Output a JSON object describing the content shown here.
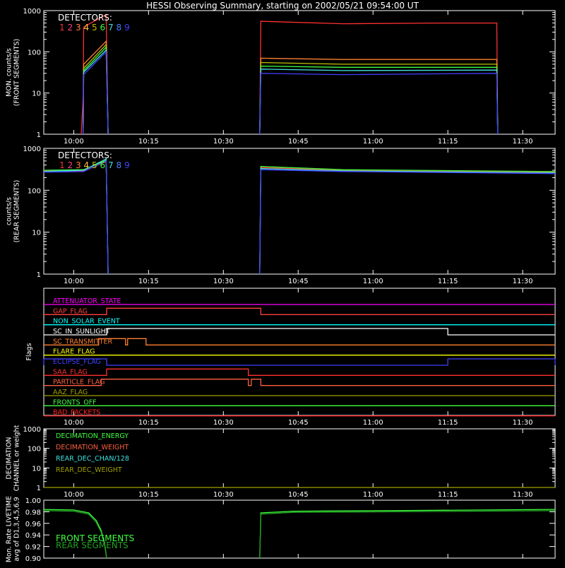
{
  "title": "HESSI Observing Summary, starting on 2002/05/21 09:54:00 UT",
  "time_ticks": [
    "10:00",
    "10:15",
    "10:30",
    "10:45",
    "11:00",
    "11:15",
    "11:30"
  ],
  "time_tick_minutes": [
    6,
    21,
    36,
    51,
    66,
    81,
    96
  ],
  "x_range_minutes": [
    0,
    102.5
  ],
  "detectors_label": "DETECTORS:",
  "detector_numbers": [
    "1",
    "2",
    "3",
    "4",
    "5",
    "6",
    "7",
    "8",
    "9"
  ],
  "detector_colors": [
    "#ff3030",
    "#ff4080",
    "#ff8030",
    "#ffc040",
    "#c0c000",
    "#40ff40",
    "#40e0e0",
    "#4080ff",
    "#4040ff"
  ],
  "chart_data": [
    {
      "type": "line",
      "name": "front",
      "ylabel": "MON. counts/s\n(FRONT SEGMENTS)",
      "ylog": true,
      "ylim": [
        1,
        1000
      ],
      "yticks": [
        "1",
        "10",
        "100",
        "1000"
      ],
      "series": [
        {
          "name": "1",
          "color": "#ff3030",
          "segments": [
            [
              [
                7.5,
                1
              ],
              [
                7.9,
                8
              ],
              [
                8.0,
                400
              ],
              [
                12.5,
                800
              ],
              [
                12.9,
                1
              ]
            ],
            [
              [
                43.3,
                1
              ],
              [
                43.5,
                550
              ],
              [
                60,
                480
              ],
              [
                80,
                500
              ],
              [
                90.8,
                500
              ],
              [
                91,
                1
              ]
            ]
          ]
        },
        {
          "name": "2",
          "color": "#ff8030",
          "segments": [
            [
              [
                7.9,
                1
              ],
              [
                8.0,
                50
              ],
              [
                12.5,
                180
              ],
              [
                12.9,
                1
              ]
            ],
            [
              [
                43.3,
                1
              ],
              [
                43.5,
                70
              ],
              [
                60,
                65
              ],
              [
                90.8,
                65
              ],
              [
                91,
                1
              ]
            ]
          ]
        },
        {
          "name": "3",
          "color": "#c0c000",
          "segments": [
            [
              [
                7.9,
                1
              ],
              [
                8.0,
                40
              ],
              [
                12.5,
                150
              ],
              [
                12.9,
                1
              ]
            ],
            [
              [
                43.3,
                1
              ],
              [
                43.5,
                55
              ],
              [
                60,
                50
              ],
              [
                90.8,
                50
              ],
              [
                91,
                1
              ]
            ]
          ]
        },
        {
          "name": "6",
          "color": "#40ff40",
          "segments": [
            [
              [
                7.9,
                1
              ],
              [
                8.0,
                35
              ],
              [
                12.5,
                130
              ],
              [
                12.9,
                1
              ]
            ],
            [
              [
                43.3,
                1
              ],
              [
                43.5,
                45
              ],
              [
                60,
                42
              ],
              [
                90.8,
                42
              ],
              [
                91,
                1
              ]
            ]
          ]
        },
        {
          "name": "7",
          "color": "#40e0e0",
          "segments": [
            [
              [
                7.9,
                1
              ],
              [
                8.0,
                32
              ],
              [
                12.5,
                110
              ],
              [
                12.9,
                1
              ]
            ],
            [
              [
                43.3,
                1
              ],
              [
                43.5,
                38
              ],
              [
                60,
                35
              ],
              [
                90.8,
                36
              ],
              [
                91,
                1
              ]
            ]
          ]
        },
        {
          "name": "8",
          "color": "#4040ff",
          "segments": [
            [
              [
                7.9,
                1
              ],
              [
                8.0,
                28
              ],
              [
                12.5,
                100
              ],
              [
                12.9,
                1
              ]
            ],
            [
              [
                43.3,
                1
              ],
              [
                43.5,
                30
              ],
              [
                60,
                28
              ],
              [
                90.8,
                30
              ],
              [
                91,
                1
              ]
            ]
          ]
        }
      ]
    },
    {
      "type": "line",
      "name": "rear",
      "ylabel": "counts/s\n(REAR SEGMENTS)",
      "ylog": true,
      "ylim": [
        1,
        1000
      ],
      "yticks": [
        "1",
        "10",
        "100",
        "1000"
      ],
      "series": [
        {
          "name": "1",
          "color": "#ff3030",
          "segments": [
            [
              [
                0,
                290
              ],
              [
                8,
                290
              ],
              [
                12.5,
                480
              ],
              [
                12.9,
                1
              ]
            ],
            [
              [
                43.3,
                1
              ],
              [
                43.5,
                350
              ],
              [
                60,
                300
              ],
              [
                102.5,
                270
              ]
            ]
          ]
        },
        {
          "name": "6",
          "color": "#40ff40",
          "segments": [
            [
              [
                0,
                300
              ],
              [
                8,
                310
              ],
              [
                12.5,
                520
              ],
              [
                12.9,
                1
              ]
            ],
            [
              [
                43.3,
                1
              ],
              [
                43.5,
                370
              ],
              [
                60,
                310
              ],
              [
                102.5,
                280
              ]
            ]
          ]
        },
        {
          "name": "8",
          "color": "#40e0e0",
          "segments": [
            [
              [
                0,
                280
              ],
              [
                8,
                300
              ],
              [
                12.5,
                560
              ],
              [
                12.9,
                1
              ]
            ],
            [
              [
                43.3,
                1
              ],
              [
                43.5,
                330
              ],
              [
                60,
                290
              ],
              [
                102.5,
                260
              ]
            ]
          ]
        },
        {
          "name": "9",
          "color": "#4040ff",
          "segments": [
            [
              [
                0,
                270
              ],
              [
                8,
                280
              ],
              [
                12.5,
                500
              ],
              [
                12.9,
                1
              ]
            ],
            [
              [
                43.3,
                1
              ],
              [
                43.5,
                310
              ],
              [
                60,
                280
              ],
              [
                102.5,
                250
              ]
            ]
          ]
        }
      ]
    },
    {
      "type": "line",
      "name": "flags",
      "ylabel": "Flags",
      "flags": [
        {
          "label": "ATTENUATOR_STATE",
          "color": "#ff00ff",
          "high": []
        },
        {
          "label": "GAP_FLAG",
          "color": "#ff4040",
          "high": [
            [
              12.6,
              43.5
            ]
          ]
        },
        {
          "label": "NON_SOLAR_EVENT",
          "color": "#00ffff",
          "high": []
        },
        {
          "label": "SC_IN_SUNLIGHT",
          "color": "#ffffff",
          "high": [
            [
              12.6,
              81
            ]
          ]
        },
        {
          "label": "SC_TRANSMITTER",
          "color": "#ff8030",
          "high": [
            [
              11,
              16.4
            ],
            [
              16.8,
              20.5
            ]
          ]
        },
        {
          "label": "FLARE_FLAG",
          "color": "#ffff00",
          "high": []
        },
        {
          "label": "ECLIPSE_FLAG",
          "color": "#4040ff",
          "high": [
            [
              0,
              12.6
            ],
            [
              81,
              102.5
            ]
          ]
        },
        {
          "label": "SAA_FLAG",
          "color": "#ff3030",
          "high": [
            [
              12.6,
              41
            ]
          ]
        },
        {
          "label": "PARTICLE_FLAG",
          "color": "#ff6040",
          "high": [
            [
              11.5,
              41
            ],
            [
              41.6,
              43.5
            ]
          ]
        },
        {
          "label": "AAZ_FLAG",
          "color": "#a0a000",
          "high": []
        },
        {
          "label": "FRONTS_OFF",
          "color": "#40ff40",
          "high": []
        },
        {
          "label": "BAD_PACKETS",
          "color": "#ff2020",
          "high": []
        }
      ]
    },
    {
      "type": "line",
      "name": "decimation",
      "ylabel": "DECIMATION\nCHANNEL or weight",
      "ylog": true,
      "ylim": [
        1,
        1000
      ],
      "yticks": [
        "1",
        "10",
        "100",
        "1000"
      ],
      "legend": [
        {
          "label": "DECIMATION_ENERGY",
          "color": "#40ff40"
        },
        {
          "label": "DECIMATION_WEIGHT",
          "color": "#ff6040"
        },
        {
          "label": "REAR_DEC_CHAN/128",
          "color": "#40e0e0"
        },
        {
          "label": "REAR_DEC_WEIGHT",
          "color": "#a0a000"
        }
      ],
      "series": [
        {
          "name": "",
          "color": "#a0a000",
          "segments": [
            [
              [
                0,
                1
              ],
              [
                102.5,
                1
              ]
            ]
          ]
        }
      ]
    },
    {
      "type": "line",
      "name": "livetime",
      "ylabel": "Mon. Rate LIVETIME\navg of D1,3,4,5,6,9",
      "ylog": false,
      "ylim": [
        0.9,
        1.0
      ],
      "yticks": [
        "0.90",
        "0.92",
        "0.94",
        "0.96",
        "0.98",
        "1.00"
      ],
      "legend": [
        {
          "label": "FRONT SEGMENTS",
          "color": "#40ff40"
        },
        {
          "label": "REAR SEGMENTS",
          "color": "#20a020"
        }
      ],
      "series": [
        {
          "name": "",
          "color": "#40ff40",
          "segments": [
            [
              [
                0,
                0.984
              ],
              [
                6,
                0.983
              ],
              [
                9,
                0.978
              ],
              [
                10.5,
                0.965
              ],
              [
                11.5,
                0.948
              ],
              [
                12.2,
                0.925
              ],
              [
                12.6,
                0.9
              ]
            ],
            [
              [
                43.3,
                0.9
              ],
              [
                43.5,
                0.978
              ],
              [
                50,
                0.981
              ],
              [
                70,
                0.982
              ],
              [
                102.5,
                0.984
              ]
            ]
          ]
        },
        {
          "name": "",
          "color": "#20a020",
          "segments": [
            [
              [
                0,
                0.982
              ],
              [
                6,
                0.981
              ],
              [
                9,
                0.976
              ],
              [
                10.5,
                0.962
              ],
              [
                11.5,
                0.945
              ],
              [
                12.2,
                0.922
              ],
              [
                12.6,
                0.9
              ]
            ],
            [
              [
                43.3,
                0.9
              ],
              [
                43.5,
                0.976
              ],
              [
                50,
                0.979
              ],
              [
                70,
                0.98
              ],
              [
                102.5,
                0.982
              ]
            ]
          ]
        }
      ]
    }
  ]
}
